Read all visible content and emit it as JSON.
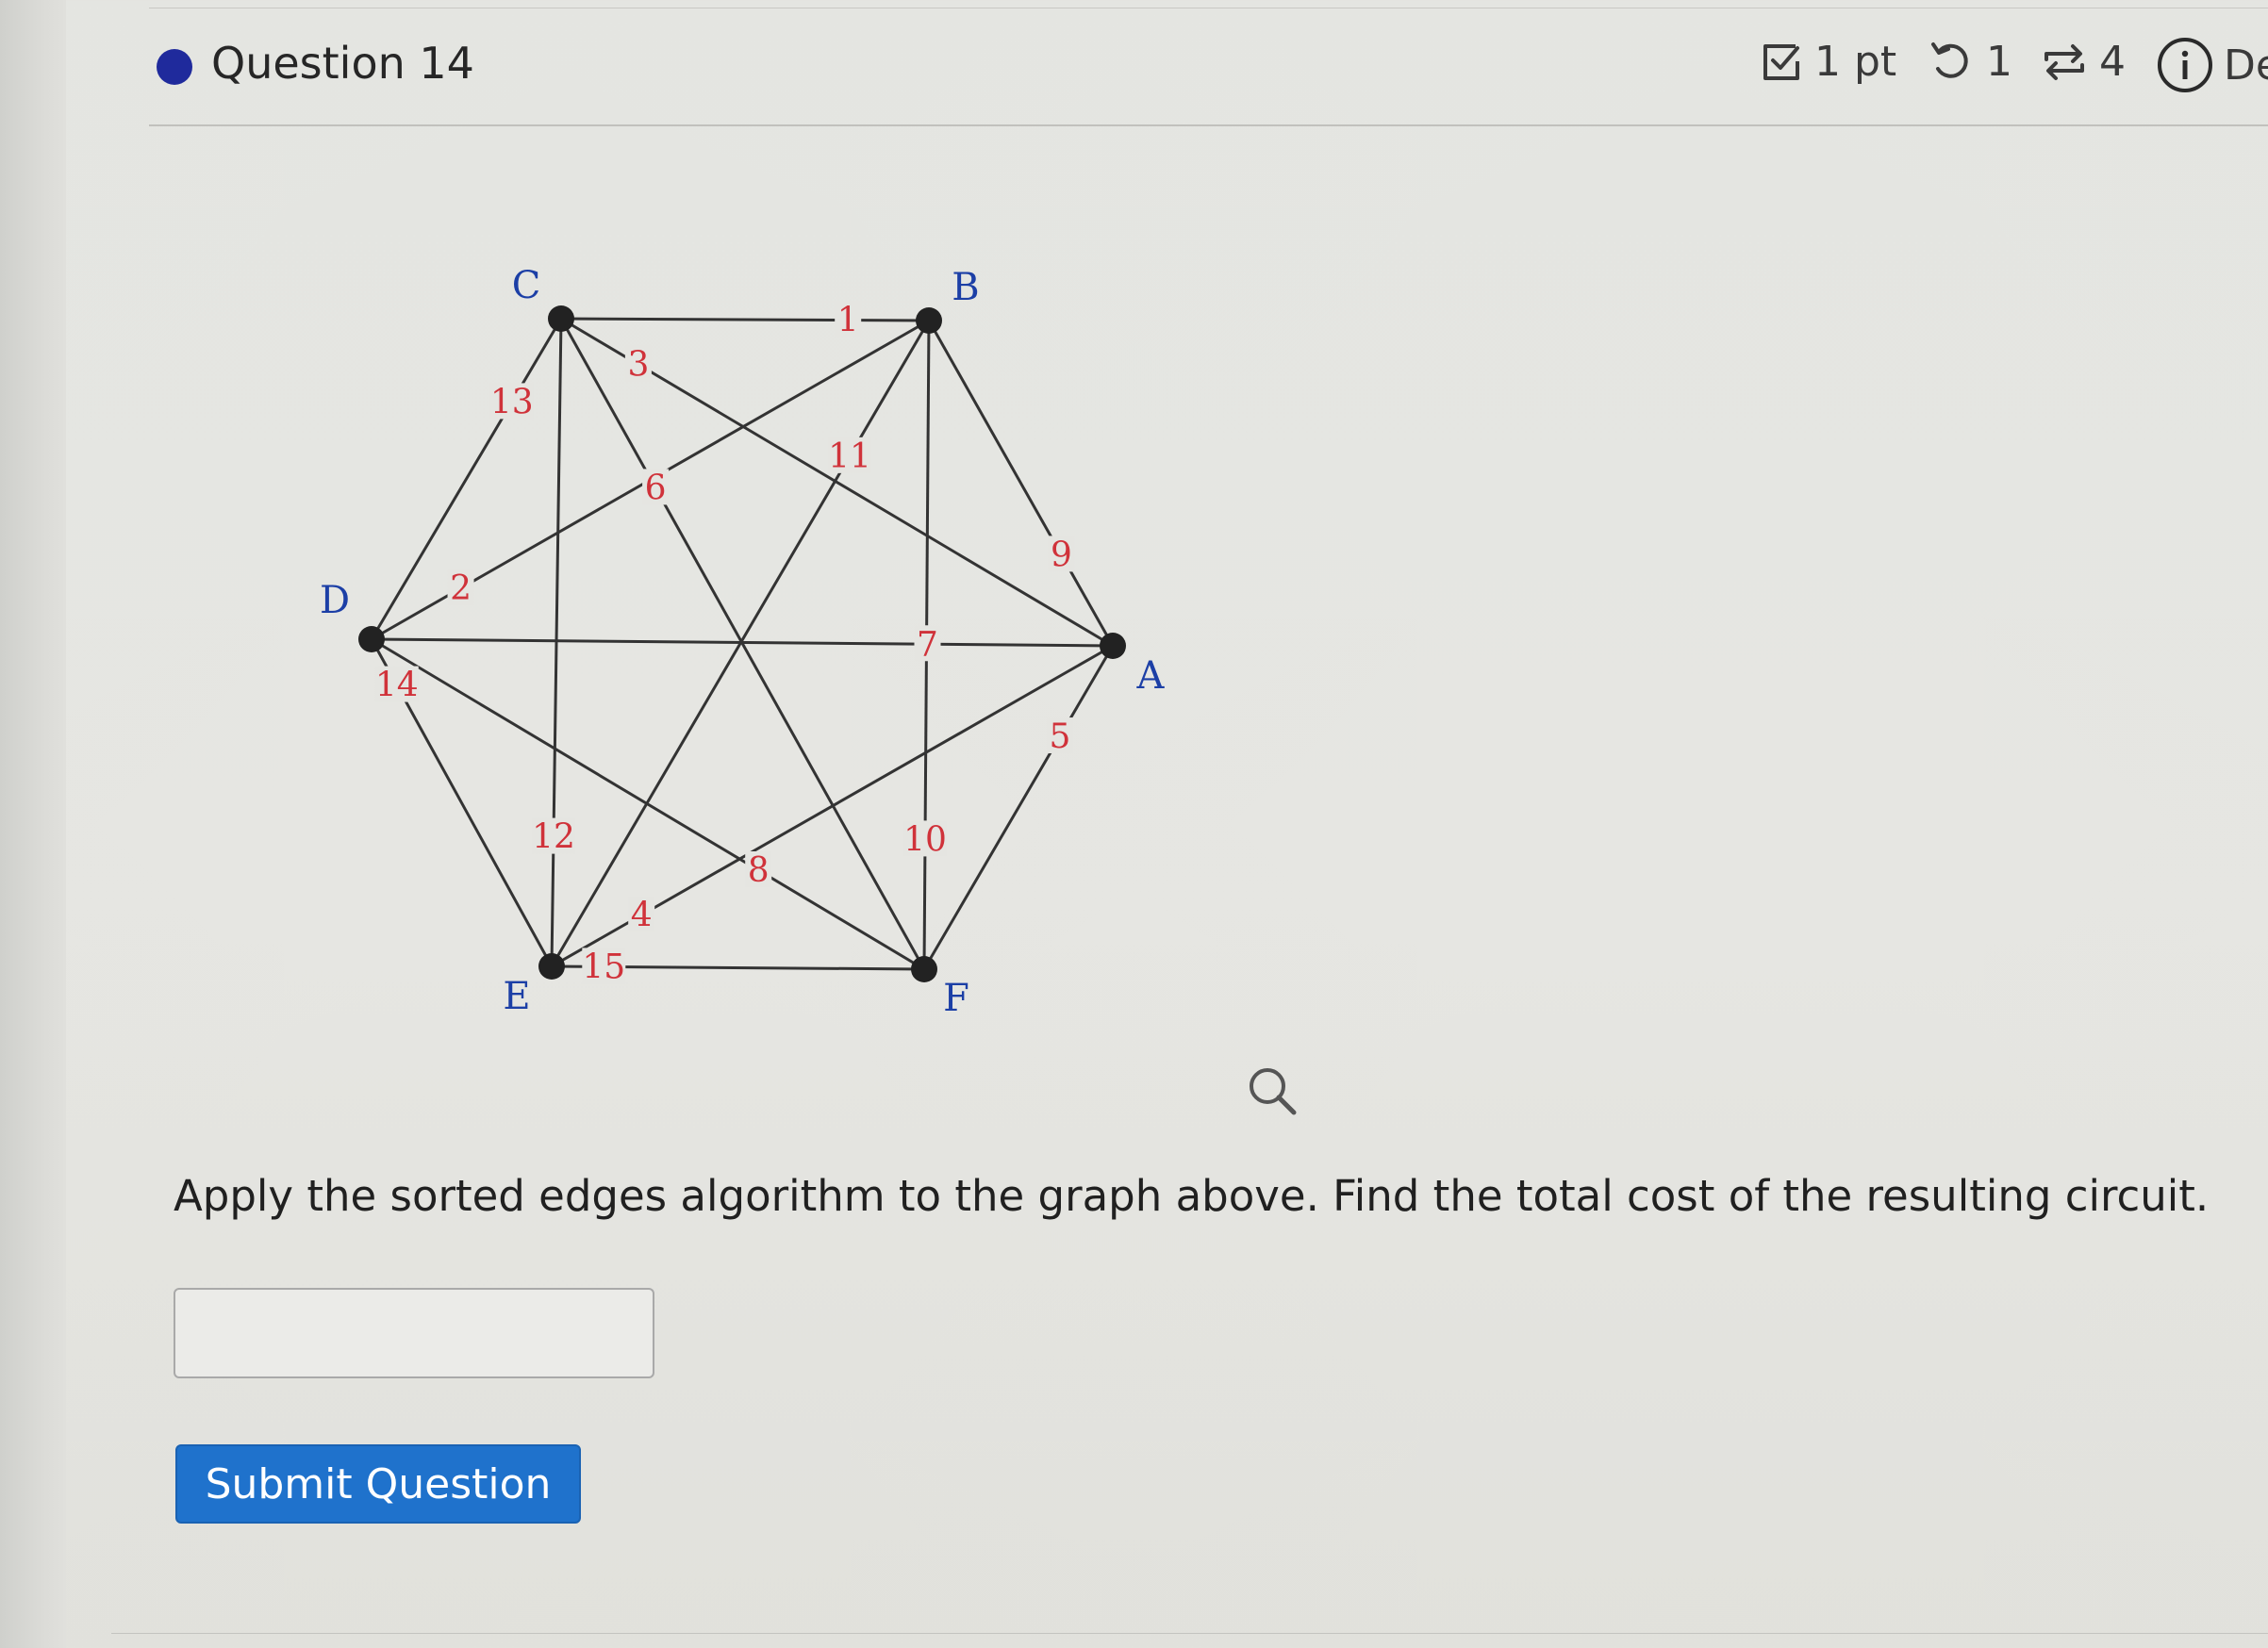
{
  "question": {
    "title": "Question 14",
    "points_label": "1 pt",
    "retry_count": "1",
    "attempts_count": "4",
    "details_label": "De",
    "text": "Apply the sorted edges algorithm to the graph above. Find the total cost of the resulting circuit.",
    "answer_value": "",
    "submit_label": "Submit Question"
  },
  "graph": {
    "vertices": [
      {
        "id": "A",
        "label": "A"
      },
      {
        "id": "B",
        "label": "B"
      },
      {
        "id": "C",
        "label": "C"
      },
      {
        "id": "D",
        "label": "D"
      },
      {
        "id": "E",
        "label": "E"
      },
      {
        "id": "F",
        "label": "F"
      }
    ],
    "edges": [
      {
        "from": "C",
        "to": "B",
        "weight": "1"
      },
      {
        "from": "D",
        "to": "B",
        "weight": "2"
      },
      {
        "from": "C",
        "to": "A",
        "weight": "3"
      },
      {
        "from": "E",
        "to": "A",
        "weight": "4"
      },
      {
        "from": "F",
        "to": "A",
        "weight": "5"
      },
      {
        "from": "C",
        "to": "F",
        "weight": "6"
      },
      {
        "from": "D",
        "to": "A",
        "weight": "7"
      },
      {
        "from": "D",
        "to": "F",
        "weight": "8"
      },
      {
        "from": "B",
        "to": "A",
        "weight": "9"
      },
      {
        "from": "B",
        "to": "F",
        "weight": "10"
      },
      {
        "from": "E",
        "to": "B",
        "weight": "11"
      },
      {
        "from": "C",
        "to": "E",
        "weight": "12"
      },
      {
        "from": "C",
        "to": "D",
        "weight": "13"
      },
      {
        "from": "D",
        "to": "E",
        "weight": "14"
      },
      {
        "from": "E",
        "to": "F",
        "weight": "15"
      }
    ],
    "vertex_label_color": "#1c3fa6",
    "weight_label_color": "#d0323a",
    "edge_color": "#333333",
    "vertex_color": "#222222"
  },
  "icons": {
    "points": "checkbox-icon",
    "retry": "undo-icon",
    "attempts": "repeat-icon",
    "details": "info-icon",
    "zoom": "magnifier-icon"
  }
}
